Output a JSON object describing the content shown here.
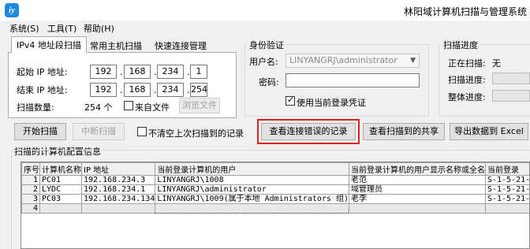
{
  "window": {
    "title": "林阳域计算机扫描与管理系统"
  },
  "menu": [
    "系统(S)",
    "工具(T)",
    "帮助(H)"
  ],
  "tabs": [
    "IPv4 地址段扫描",
    "常用主机扫描",
    "快速连接管理"
  ],
  "scan": {
    "start_label": "起始 IP 地址:",
    "end_label": "结束 IP 地址:",
    "start_ip": [
      "192",
      "168",
      "234",
      "1"
    ],
    "end_ip": [
      "192",
      "168",
      "234",
      "254"
    ],
    "count_label": "扫描数量:",
    "count_value": "254 个",
    "from_file_label": "来自文件",
    "browse_label": "浏览文件"
  },
  "auth": {
    "title": "身份验证",
    "user_label": "用户名:",
    "user_value": "LINYANGRJ\\administrator",
    "password_label": "密码:",
    "use_current_label": "使用当前登录凭证"
  },
  "progress": {
    "title": "扫描进度",
    "scanning_label": "正在扫描:",
    "scanning_value": "无",
    "scan_progress_label": "扫描进度:",
    "total_progress_label": "整体进度:"
  },
  "actions": {
    "start": "开始扫描",
    "stop": "中断扫描",
    "no_clear": "不清空上次扫描到的记录",
    "view_errors": "查看连接错误的记录",
    "view_shares": "查看扫描到的共享",
    "export": "导出数据到 Excel"
  },
  "results": {
    "title": "扫描的计算机配置信息",
    "columns": [
      "序号",
      "计算机名称",
      "IP 地址",
      "当前登录计算机的用户",
      "当前登录计算机的用户显示名称或全名",
      "当前登录"
    ],
    "rows": [
      [
        "1",
        "PC01",
        "192.168.234.3",
        "LINYANGRJ\\1008",
        "老范",
        "S-1-5-21-"
      ],
      [
        "2",
        "LYDC",
        "192.168.234.1",
        "LINYANGRJ\\administrator",
        "域管理员",
        "S-1-5-21-"
      ],
      [
        "3",
        "PC03",
        "192.168.234.134",
        "LINYANGRJ\\1009(属于本地 Administrators 组)",
        "老李",
        "S-1-5-21-"
      ],
      [
        "4",
        "",
        "",
        "",
        "",
        ""
      ]
    ]
  }
}
